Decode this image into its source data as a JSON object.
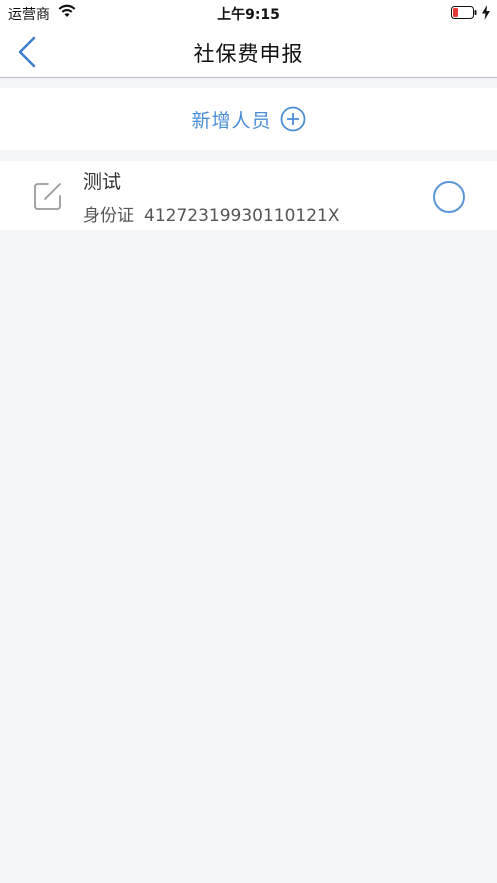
{
  "status_bar": {
    "carrier": "运营商",
    "time": "上午9:15",
    "icons": [
      "wifi-icon",
      "battery-low-icon",
      "charging-bolt-icon"
    ]
  },
  "nav": {
    "title": "社保费申报",
    "back_icon": "chevron-left-icon"
  },
  "add_person": {
    "label": "新增人员",
    "icon": "plus-circle-icon"
  },
  "persons": [
    {
      "name": "测试",
      "id_label": "身份证",
      "id_number": "41272319930110121X",
      "selected": false
    }
  ],
  "colors": {
    "accent": "#4a8fd6",
    "background": "#f3f5f9",
    "battery_low": "#e53935"
  }
}
